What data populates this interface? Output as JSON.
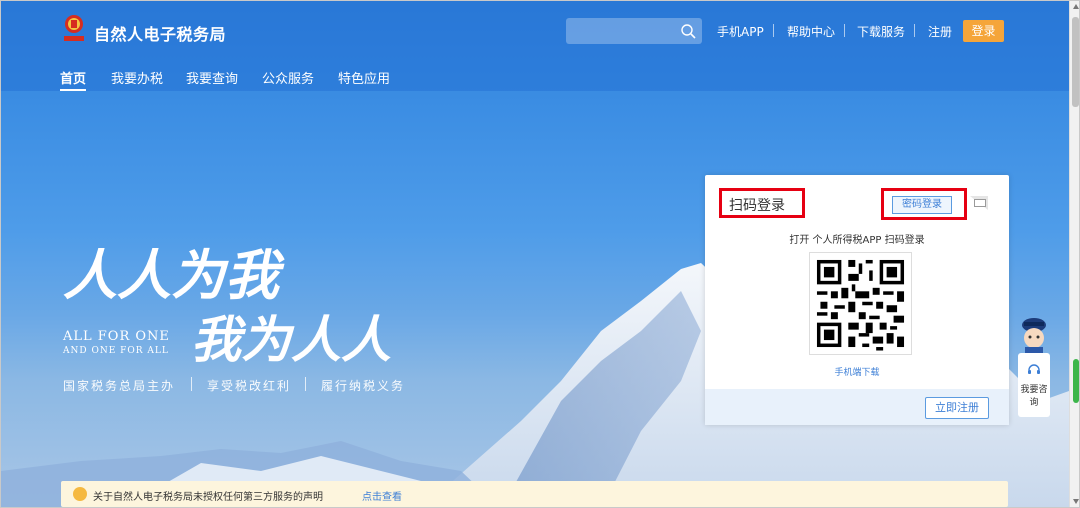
{
  "header": {
    "site_title": "自然人电子税务局",
    "search_placeholder": "",
    "links": [
      "手机APP",
      "帮助中心",
      "下载服务",
      "注册"
    ],
    "login_label": "登录"
  },
  "main_nav": [
    "首页",
    "我要办税",
    "我要查询",
    "公众服务",
    "特色应用"
  ],
  "hero": {
    "calligraphy_line1": "人人为我",
    "calligraphy_line2": "我为人人",
    "en_line1": "ALL FOR ONE",
    "en_line2": "AND ONE FOR ALL",
    "slogans": [
      "国家税务总局主办",
      "享受税改红利",
      "履行纳税义务"
    ]
  },
  "login_card": {
    "title": "扫码登录",
    "password_tab": "密码登录",
    "scan_hint": "打开 个人所得税APP 扫码登录",
    "download_link": "手机端下载",
    "register_button": "立即注册"
  },
  "notice": {
    "text": "关于自然人电子税务局未授权任何第三方服务的声明",
    "link": "点击查看"
  },
  "consult": {
    "label": "我要咨询"
  },
  "colors": {
    "accent_orange": "#f5a53a",
    "link_blue": "#3d7fd6",
    "highlight_red": "#e60012"
  }
}
